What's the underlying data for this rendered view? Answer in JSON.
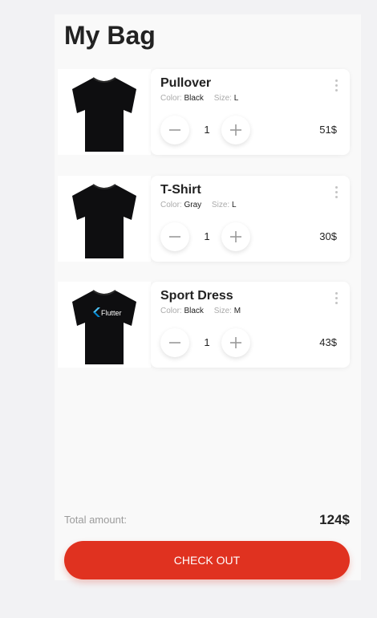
{
  "header": {
    "title": "My Bag"
  },
  "items": [
    {
      "name": "Pullover",
      "color_label": "Color:",
      "color": "Black",
      "size_label": "Size:",
      "size": "L",
      "quantity": "1",
      "price": "51$"
    },
    {
      "name": "T-Shirt",
      "color_label": "Color:",
      "color": "Gray",
      "size_label": "Size:",
      "size": "L",
      "quantity": "1",
      "price": "30$"
    },
    {
      "name": "Sport Dress",
      "color_label": "Color:",
      "color": "Black",
      "size_label": "Size:",
      "size": "M",
      "quantity": "1",
      "price": "43$",
      "print": "Flutter"
    }
  ],
  "summary": {
    "total_label": "Total amount:",
    "total_value": "124$"
  },
  "checkout": {
    "label": "CHECK OUT"
  },
  "colors": {
    "accent": "#e03220",
    "background": "#f9f9f9",
    "card": "#ffffff"
  }
}
